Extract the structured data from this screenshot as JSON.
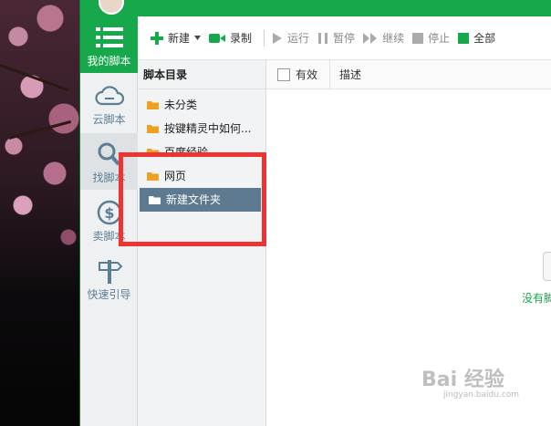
{
  "nav": {
    "items": [
      {
        "label": "我的脚本",
        "icon": "list-icon",
        "active": true
      },
      {
        "label": "云脚本",
        "icon": "cloud-icon"
      },
      {
        "label": "找脚本",
        "icon": "search-icon"
      },
      {
        "label": "卖脚本",
        "icon": "dollar-icon"
      },
      {
        "label": "快速引导",
        "icon": "signpost-icon"
      }
    ]
  },
  "toolbar": {
    "new_label": "新建",
    "record_label": "录制",
    "run_label": "运行",
    "pause_label": "暂停",
    "resume_label": "继续",
    "stop_label": "停止",
    "all_label": "全部"
  },
  "folders": {
    "header": "脚本目录",
    "items": [
      {
        "label": "未分类"
      },
      {
        "label": "按键精灵中如何..."
      },
      {
        "label": "百度经验"
      },
      {
        "label": "网页"
      },
      {
        "label": "新建文件夹",
        "selected": true
      }
    ]
  },
  "list": {
    "col_valid": "有效",
    "col_desc": "描述",
    "empty_text": "没有脚"
  },
  "colors": {
    "accent": "#17a84c",
    "selected": "#5e7a90",
    "highlight": "#ee3333"
  },
  "watermark": {
    "brand": "Bai 经验",
    "url": "jingyan.baidu.com"
  }
}
